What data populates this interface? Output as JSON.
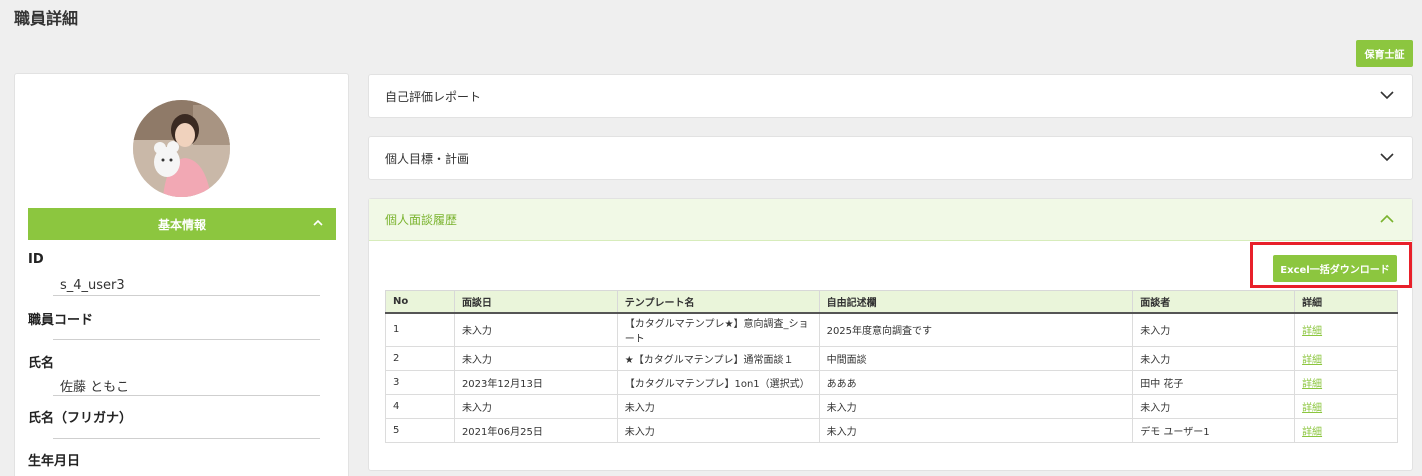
{
  "page": {
    "title": "職員詳細"
  },
  "top_button": {
    "label": "保育士証"
  },
  "profile": {
    "section_title": "基本情報",
    "fields": [
      {
        "label": "ID",
        "value": "s_4_user3"
      },
      {
        "label": "職員コード",
        "value": ""
      },
      {
        "label": "氏名",
        "value": "佐藤 ともこ"
      },
      {
        "label": "氏名（フリガナ）",
        "value": ""
      },
      {
        "label": "生年月日",
        "value": ""
      }
    ]
  },
  "accordions": [
    {
      "title": "自己評価レポート",
      "open": false
    },
    {
      "title": "個人目標・計画",
      "open": false
    },
    {
      "title": "個人面談履歴",
      "open": true
    }
  ],
  "interview": {
    "download_label": "Excel一括ダウンロード",
    "columns": [
      "No",
      "面談日",
      "テンプレート名",
      "自由記述欄",
      "面談者",
      "詳細"
    ],
    "rows": [
      {
        "no": "1",
        "date": "未入力",
        "template": "【カタグルマテンプレ★】意向調査_ショート",
        "note": "2025年度意向調査です",
        "interviewer": "未入力",
        "detail": "詳細"
      },
      {
        "no": "2",
        "date": "未入力",
        "template": "★【カタグルマテンプレ】通常面談１",
        "note": "中間面談",
        "interviewer": "未入力",
        "detail": "詳細"
      },
      {
        "no": "3",
        "date": "2023年12月13日",
        "template": "【カタグルマテンプレ】1on1（選択式）",
        "note": "あああ",
        "interviewer": "田中 花子",
        "detail": "詳細"
      },
      {
        "no": "4",
        "date": "未入力",
        "template": "未入力",
        "note": "未入力",
        "interviewer": "未入力",
        "detail": "詳細"
      },
      {
        "no": "5",
        "date": "2021年06月25日",
        "template": "未入力",
        "note": "未入力",
        "interviewer": "デモ ユーザー1",
        "detail": "詳細"
      }
    ]
  },
  "colors": {
    "accent": "#8cc63f",
    "highlight": "#e8202a"
  }
}
